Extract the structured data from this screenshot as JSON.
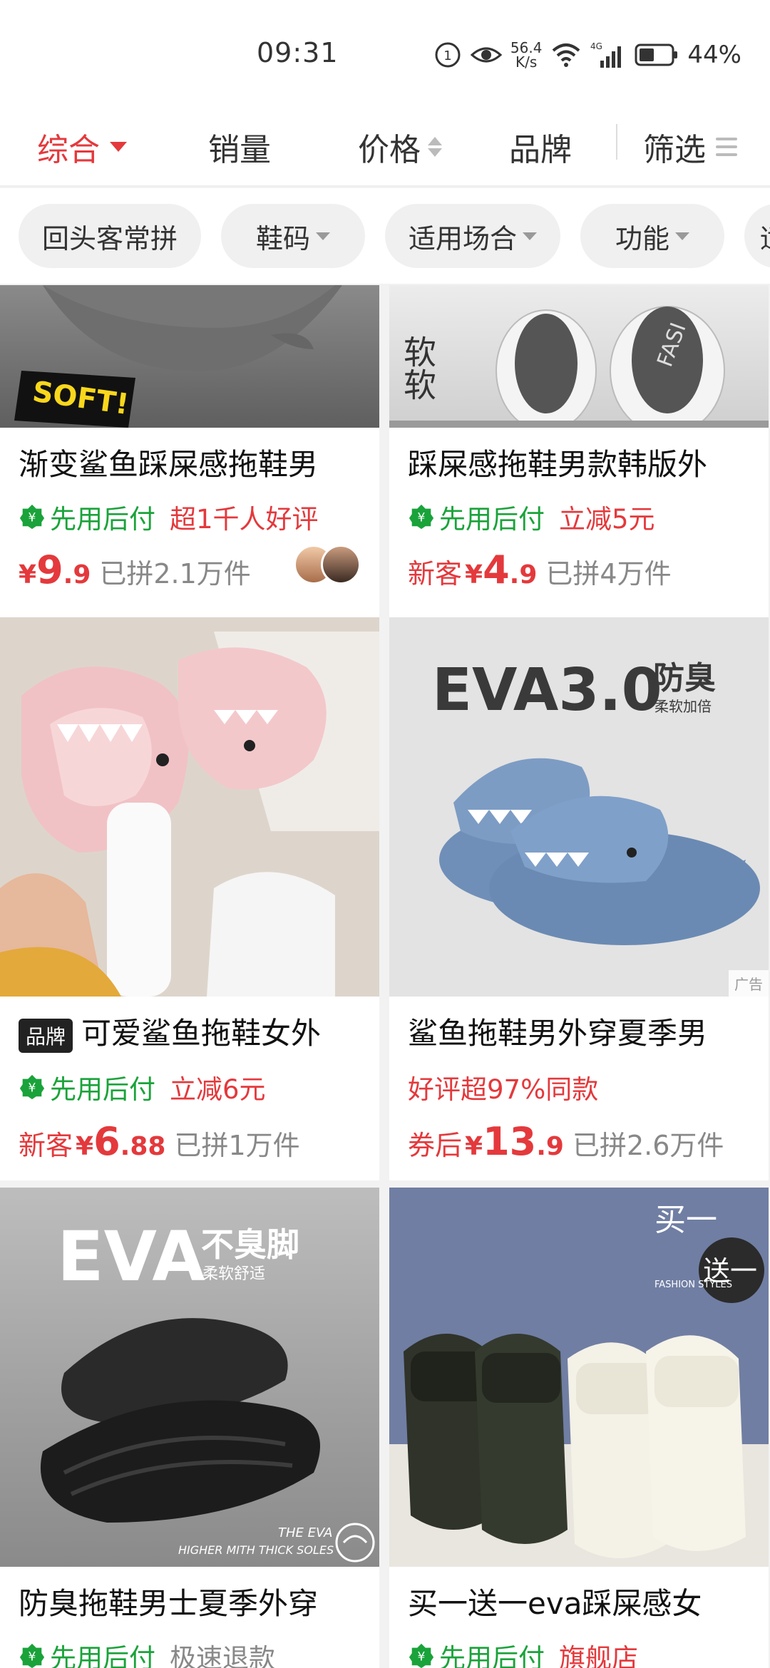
{
  "status_bar": {
    "time": "09:31",
    "net_speed_value": "56.4",
    "net_speed_unit": "K/s",
    "network_type": "4G",
    "battery_percent": "44%"
  },
  "sort_tabs": [
    {
      "label": "综合",
      "active": true
    },
    {
      "label": "销量"
    },
    {
      "label": "价格"
    },
    {
      "label": "品牌"
    },
    {
      "label": "筛选"
    }
  ],
  "filter_chips": [
    "回头客常拼",
    "鞋码",
    "适用场合",
    "功能",
    "适"
  ],
  "products": [
    {
      "title": "渐变鲨鱼踩屎感拖鞋男",
      "pay_label": "先用后付",
      "promo": "超1千人好评",
      "price_prefix": "",
      "currency": "¥",
      "price_int": "9",
      "price_dec": ".9",
      "sold": "已拼2.1万件",
      "image_text": "SOFT!"
    },
    {
      "title": "踩屎感拖鞋男款韩版外",
      "pay_label": "先用后付",
      "promo": "立减5元",
      "price_prefix": "新客",
      "currency": "¥",
      "price_int": "4",
      "price_dec": ".9",
      "sold": "已拼4万件",
      "image_text": "软软"
    },
    {
      "brand_badge": "品牌",
      "title": "可爱鲨鱼拖鞋女外",
      "pay_label": "先用后付",
      "promo": "立减6元",
      "price_prefix": "新客",
      "currency": "¥",
      "price_int": "6",
      "price_dec": ".88",
      "sold": "已拼1万件"
    },
    {
      "title": "鲨鱼拖鞋男外穿夏季男",
      "promo_only": "好评超97%同款",
      "price_prefix": "券后",
      "currency": "¥",
      "price_int": "13",
      "price_dec": ".9",
      "sold": "已拼2.6万件",
      "image_text_big": "EVA3.0",
      "image_text_side1": "防臭",
      "image_text_side2": "柔软加倍",
      "ad_label": "广告"
    },
    {
      "title": "防臭拖鞋男士夏季外穿",
      "pay_label": "先用后付",
      "promo_gray": "极速退款",
      "image_text_big": "EVA",
      "image_text_side1": "不臭脚",
      "image_text_side2": "柔软舒适",
      "image_foot1": "THE EVA",
      "image_foot2": "HIGHER MITH THICK SOLES"
    },
    {
      "title": "买一送一eva踩屎感女",
      "pay_label": "先用后付",
      "promo": "旗舰店",
      "image_text_a": "买一",
      "image_text_b": "送一",
      "image_text_c": "FASHION STYLES"
    }
  ],
  "colors": {
    "accent_red": "#e4393c",
    "pay_green": "#1aa33a",
    "text_gray": "#888888"
  }
}
